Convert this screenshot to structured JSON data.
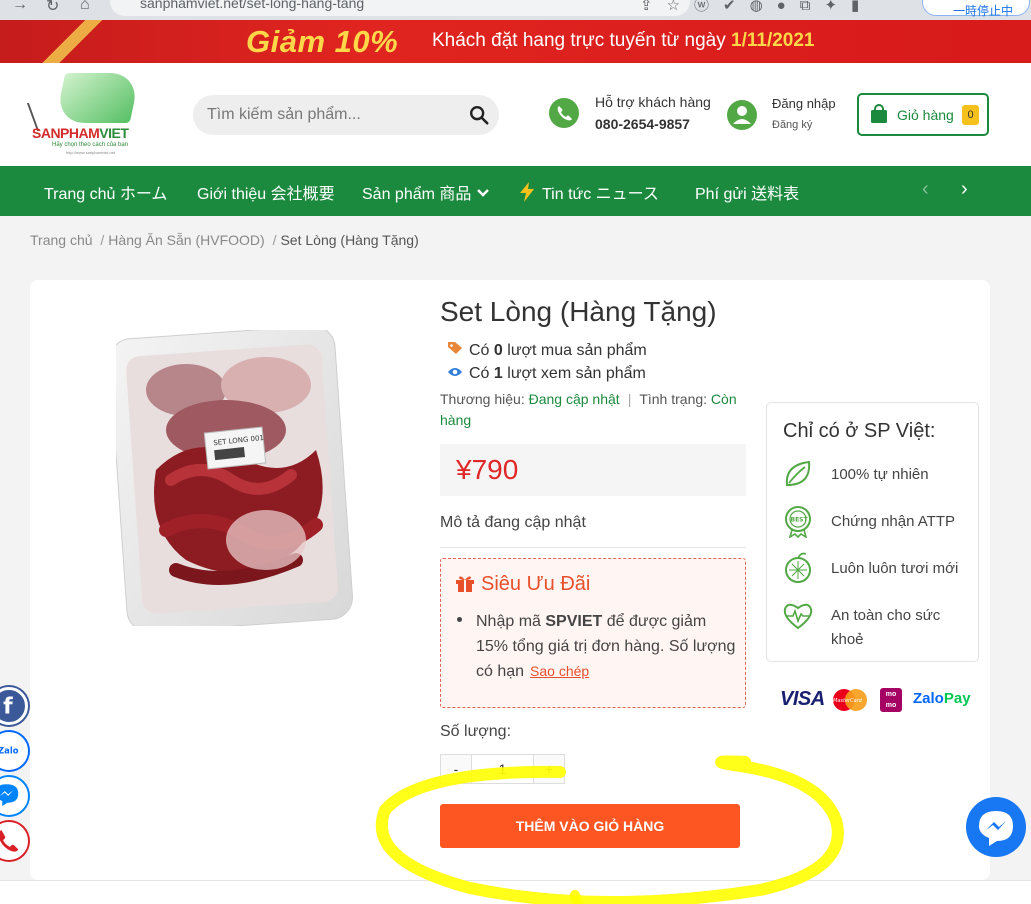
{
  "browser": {
    "url": "sanphamviet.net/set-long-hang-tang",
    "pause_label": "一時停止中"
  },
  "promo": {
    "headline": "Giảm 10%",
    "text": "Khách đặt hang trực tuyến từ ngày",
    "date": "1/11/2021"
  },
  "logo": {
    "name_part1": "SANPHAM",
    "name_part2": "VIET",
    "slogan": "Hãy chọn theo cách của bạn",
    "url": "http://www.sanphamviet.net"
  },
  "search": {
    "placeholder": "Tìm kiếm sản phẩm..."
  },
  "support": {
    "label": "Hỗ trợ khách hàng",
    "phone": "080-2654-9857"
  },
  "account": {
    "login": "Đăng nhập",
    "register": "Đăng ký"
  },
  "cart": {
    "label": "Giỏ hàng",
    "count": "0"
  },
  "nav": {
    "items": [
      "Trang chủ ホーム",
      "Giới thiệu 会社概要",
      "Sản phẩm 商品",
      "Tin tức ニュース",
      "Phí gửi 送料表"
    ]
  },
  "breadcrumb": {
    "items": [
      "Trang chủ",
      "Hàng Ăn Sẵn (HVFOOD)",
      "Set Lòng (Hàng Tặng)"
    ],
    "separator": "/"
  },
  "product": {
    "photo_label": "SET LONG 001",
    "title": "Set Lòng (Hàng Tặng)",
    "buy_prefix": "Có",
    "buy_count": "0",
    "buy_suffix": "lượt mua sản phẩm",
    "view_prefix": "Có",
    "view_count": "1",
    "view_suffix": "lượt xem sản phẩm",
    "brand_label": "Thương hiệu:",
    "brand_value": "Đang cập nhật",
    "status_label": "Tình trạng:",
    "status_value": "Còn hàng",
    "price": "¥790",
    "description": "Mô tả đang cập nhật"
  },
  "deal": {
    "title": "Siêu Ưu Đãi",
    "text_before": "Nhập mã",
    "code": "SPVIET",
    "text_after": "để được giảm 15% tổng giá trị đơn hàng. Số lượng có hạn",
    "copy_label": "Sao chép"
  },
  "quantity": {
    "label": "Số lượng:",
    "minus": "-",
    "value": "1",
    "plus": "+"
  },
  "add_to_cart": "THÊM VÀO GIỎ HÀNG",
  "sidebox": {
    "title": "Chỉ có ở SP Việt:",
    "features": [
      {
        "icon": "leaf-icon",
        "text": "100% tự nhiên"
      },
      {
        "icon": "best-badge-icon",
        "text": "Chứng nhận ATTP"
      },
      {
        "icon": "fresh-fruit-icon",
        "text": "Luôn luôn tươi mới"
      },
      {
        "icon": "heart-pulse-icon",
        "text": "An toàn cho sức khoẻ"
      }
    ]
  },
  "payments": {
    "visa": "VISA",
    "mastercard": "MasterCard",
    "momo": "mo mo",
    "zalopay_a": "Zalo",
    "zalopay_b": "Pay"
  },
  "social": {
    "zalo": "Zalo"
  },
  "colors": {
    "brand_green": "#1c8a3e",
    "promo_red": "#d71a1a",
    "price_red": "#e02727",
    "cta_orange": "#fe5622",
    "annotation_yellow": "#ffff00"
  }
}
